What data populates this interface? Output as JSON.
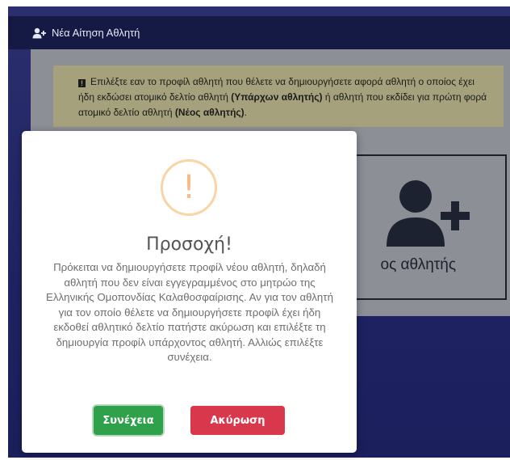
{
  "header": {
    "title": "Νέα Αίτηση Αθλητή",
    "icon": "user-plus-icon"
  },
  "info": {
    "text_1": "Επιλέξτε εαν το προφίλ αθλητή που θέλετε να δημιουργήσετε αφορά αθλητή ο οποίος έχει ήδη εκδώσει ατομικό δελτίο αθλητή ",
    "bold_1": "(Υπάρχων αθλητής)",
    "text_2": " ή αθλητή που εκδίδει για πρώτη φορά ατομικό δελτίο αθλητή ",
    "bold_2": "(Νέος αθλητής)",
    "text_3": "."
  },
  "card": {
    "label": "ος αθλητής",
    "icon": "user-plus-icon"
  },
  "modal": {
    "icon_glyph": "!",
    "title": "Προσοχή!",
    "text": "Πρόκειται να δημιουργήσετε προφίλ νέου αθλητή, δηλαδή αθλητή που δεν είναι εγγεγραμμένος στο μητρώο της Ελληνικής Ομοπονδίας Καλαθοσφαίρισης. Αν για τον αθλητή για τον οποίο θέλετε να δημιουργήσετε προφίλ έχει ήδη εκδοθεί αθλητικό δελτίο πατήστε ακύρωση και επιλέξτε τη δημιουργία προφίλ υπάρχοντος αθλητή. Αλλιώς επιλέξτε συνέχεια.",
    "confirm_label": "Συνέχεια",
    "cancel_label": "Ακύρωση"
  },
  "colors": {
    "confirm": "#2ea14a",
    "cancel": "#d9374b",
    "warning_icon": "#f8bb86",
    "header_bg": "#151a45"
  }
}
